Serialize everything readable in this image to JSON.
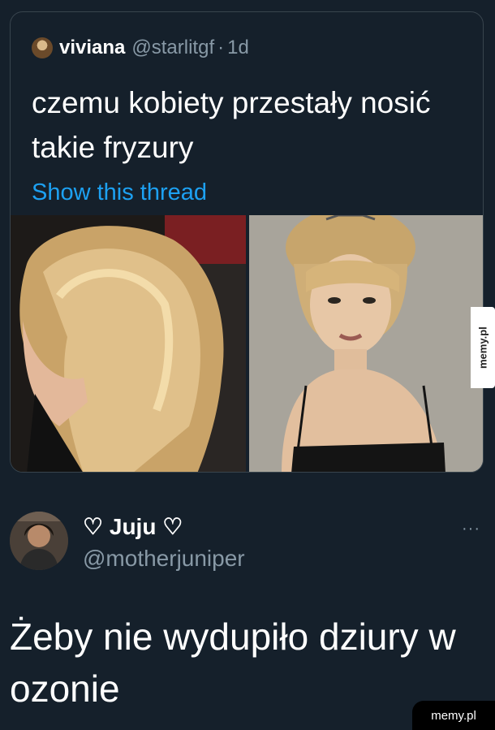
{
  "quoted_tweet": {
    "author_name": "viviana",
    "author_handle": "@starlitgf",
    "separator": "·",
    "time": "1d",
    "text": "czemu kobiety przestały nosić takie fryzury",
    "show_thread_label": "Show this thread",
    "images": [
      {
        "description_icon": "photo-blonde-hair-side-profile"
      },
      {
        "description_icon": "photo-bardot-portrait"
      }
    ]
  },
  "reply": {
    "author_name": "♡ Juju ♡",
    "author_handle": "@motherjuniper",
    "more_label": "···",
    "text": "Żeby nie wydupiło dziury w ozonie"
  },
  "watermarks": {
    "side": "memy.pl",
    "bottom": "memy.pl"
  },
  "colors": {
    "background": "#15202b",
    "border": "#38444d",
    "link": "#1da1f2",
    "muted": "#8899a6",
    "text": "#ffffff"
  }
}
